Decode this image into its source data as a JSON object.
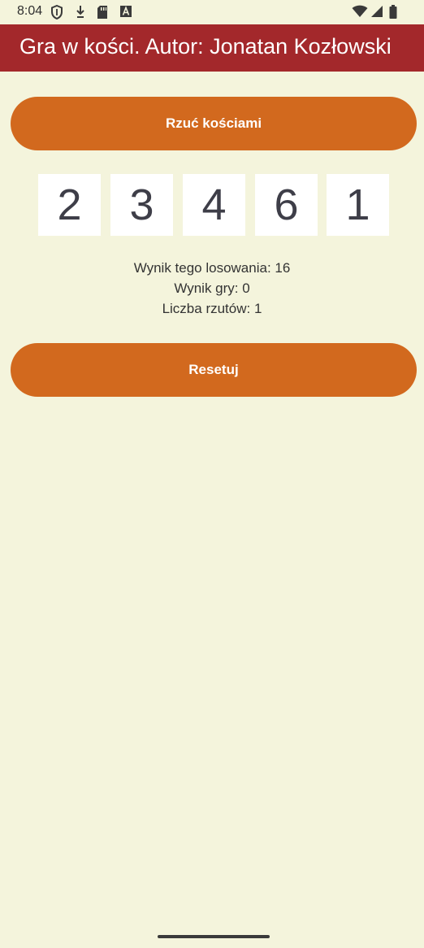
{
  "status_bar": {
    "time": "8:04",
    "left_icons": [
      "shield-icon",
      "download-icon",
      "sd-card-icon",
      "font-a-icon"
    ],
    "right_icons": [
      "wifi-icon",
      "cell-signal-icon",
      "battery-icon"
    ]
  },
  "app_bar": {
    "title": "Gra w kości. Autor: Jonatan Kozłowski",
    "color": "#a3282b"
  },
  "roll_button": {
    "label": "Rzuć kościami"
  },
  "dice": [
    "2",
    "3",
    "4",
    "6",
    "1"
  ],
  "results": {
    "roll_score": "Wynik tego losowania: 16",
    "game_score": "Wynik gry: 0",
    "roll_count": "Liczba rzutów: 1"
  },
  "reset_button": {
    "label": "Resetuj"
  },
  "colors": {
    "background": "#f4f4dc",
    "accent": "#d2691e",
    "header": "#a3282b"
  }
}
